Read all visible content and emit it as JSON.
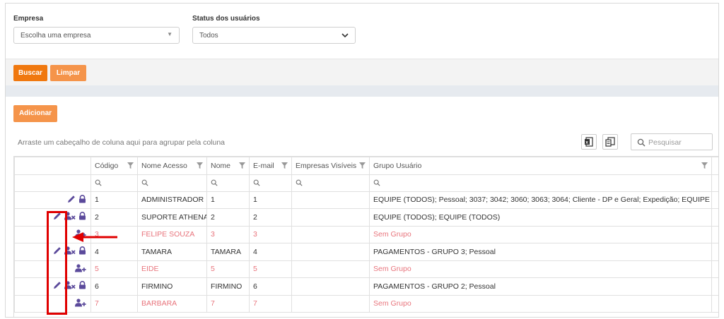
{
  "filters": {
    "empresa_label": "Empresa",
    "empresa_placeholder": "Escolha uma empresa",
    "status_label": "Status dos usuários",
    "status_value": "Todos"
  },
  "actions": {
    "buscar": "Buscar",
    "limpar": "Limpar",
    "adicionar": "Adicionar"
  },
  "grid": {
    "group_hint": "Arraste um cabeçalho de coluna aqui para agrupar pela coluna",
    "search_placeholder": "Pesquisar",
    "columns": [
      "Código",
      "Nome Acesso",
      "Nome",
      "E-mail",
      "Empresas Visíveis",
      "Grupo Usuário"
    ],
    "rows": [
      {
        "codigo": "1",
        "nome_acesso": "ADMINISTRADOR",
        "nome": "1",
        "email": "1",
        "empresas": "",
        "grupo": "EQUIPE (TODOS); Pessoal; 3037; 3042; 3060; 3063; 3064; Cliente - DP e Geral; Expedição; EQUIPE (TODOS)",
        "icons": [
          "pencil-icon",
          "lock-icon"
        ]
      },
      {
        "codigo": "2",
        "nome_acesso": "SUPORTE ATHENAS",
        "nome": "2",
        "email": "2",
        "empresas": "",
        "grupo": "EQUIPE (TODOS); EQUIPE (TODOS)",
        "icons": [
          "pencil-icon",
          "user-remove-icon",
          "lock-icon"
        ]
      },
      {
        "codigo": "3",
        "nome_acesso": "FELIPE SOUZA",
        "nome": "3",
        "email": "3",
        "empresas": "",
        "grupo": "Sem Grupo",
        "icons": [
          "user-add-icon"
        ]
      },
      {
        "codigo": "4",
        "nome_acesso": "TAMARA",
        "nome": "TAMARA",
        "email": "4",
        "empresas": "",
        "grupo": "PAGAMENTOS - GRUPO 3; Pessoal",
        "icons": [
          "pencil-icon",
          "user-remove-icon",
          "lock-icon"
        ]
      },
      {
        "codigo": "5",
        "nome_acesso": "EIDE",
        "nome": "5",
        "email": "5",
        "empresas": "",
        "grupo": "Sem Grupo",
        "icons": [
          "user-add-icon"
        ]
      },
      {
        "codigo": "6",
        "nome_acesso": "FIRMINO",
        "nome": "FIRMINO",
        "email": "6",
        "empresas": "",
        "grupo": "PAGAMENTOS - GRUPO 2; Pessoal",
        "icons": [
          "pencil-icon",
          "user-remove-icon",
          "lock-icon"
        ]
      },
      {
        "codigo": "7",
        "nome_acesso": "BARBARA",
        "nome": "7",
        "email": "7",
        "empresas": "",
        "grupo": "Sem Grupo",
        "icons": [
          "user-add-icon"
        ]
      }
    ]
  },
  "colors": {
    "accent_orange": "#f0780f",
    "light_orange": "#f5944a",
    "inactive_row_text": "#e8747c",
    "icon_purple": "#5b4a9b",
    "annotation_red": "#e00000"
  }
}
